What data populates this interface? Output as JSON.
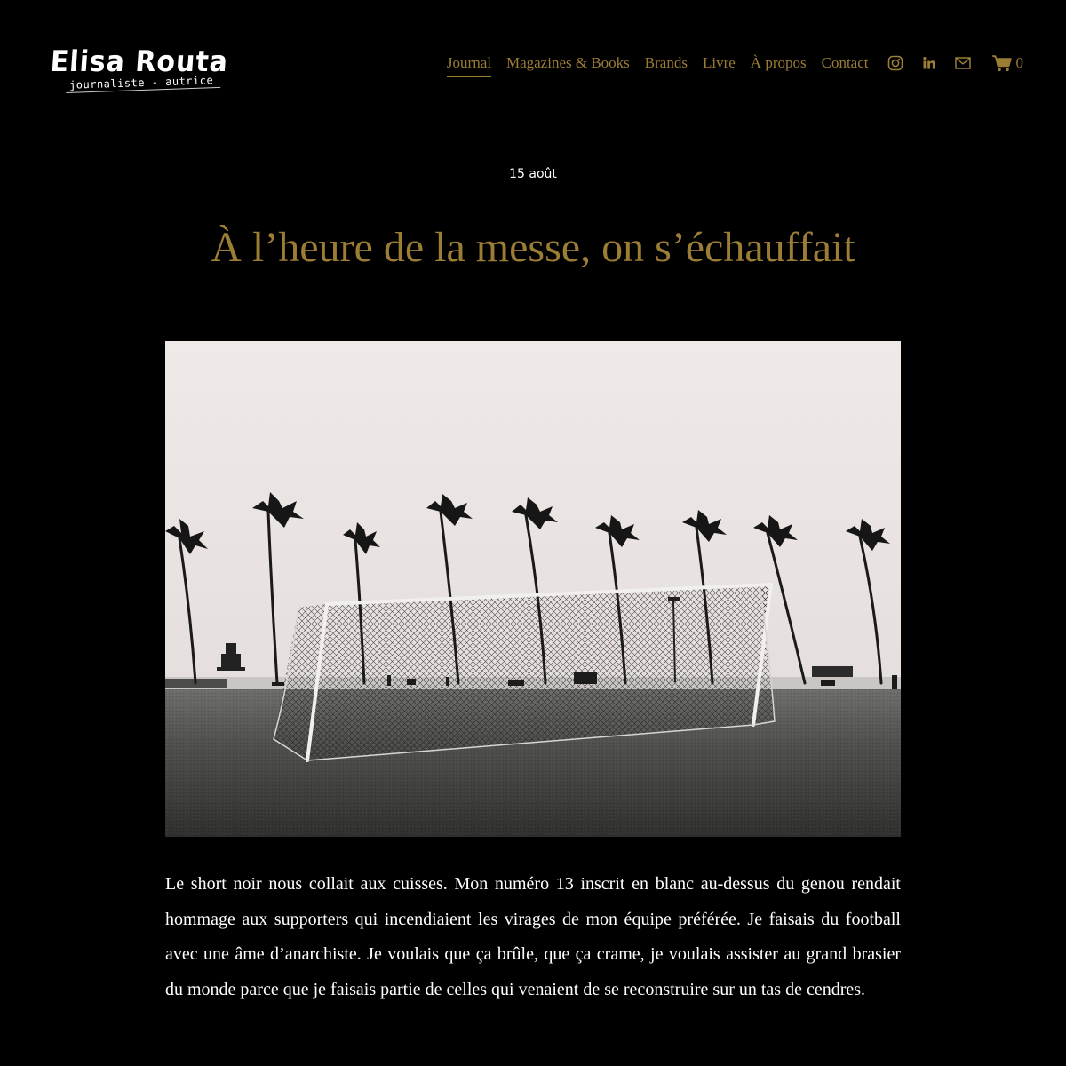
{
  "site": {
    "logo_name": "Elisa Routa",
    "logo_tagline": "journaliste - autrice"
  },
  "nav": {
    "items": [
      {
        "label": "Journal",
        "active": true
      },
      {
        "label": "Magazines & Books",
        "active": false
      },
      {
        "label": "Brands",
        "active": false
      },
      {
        "label": "Livre",
        "active": false
      },
      {
        "label": "À propos",
        "active": false
      },
      {
        "label": "Contact",
        "active": false
      }
    ],
    "social_icons": [
      "instagram-icon",
      "linkedin-icon",
      "email-icon"
    ],
    "cart_icon": "cart-icon",
    "cart_count": "0"
  },
  "colors": {
    "background": "#000000",
    "accent": "#9b7d34",
    "text": "#ffffff"
  },
  "post": {
    "date": "15 août",
    "title": "À l’heure de la messe, on s’échauffait",
    "image_subject": "black-and-white-photo-soccer-goal-palm-trees",
    "body": "Le short noir nous collait aux cuisses. Mon numéro 13 inscrit en blanc au-dessus du genou rendait hommage aux supporters qui incendiaient les virages de mon équipe préférée. Je faisais du football avec une âme d’anarchiste. Je voulais que ça brûle, que ça crame, je voulais assister au grand brasier du monde parce que je faisais partie de celles qui venaient de se reconstruire sur un tas de cendres."
  }
}
